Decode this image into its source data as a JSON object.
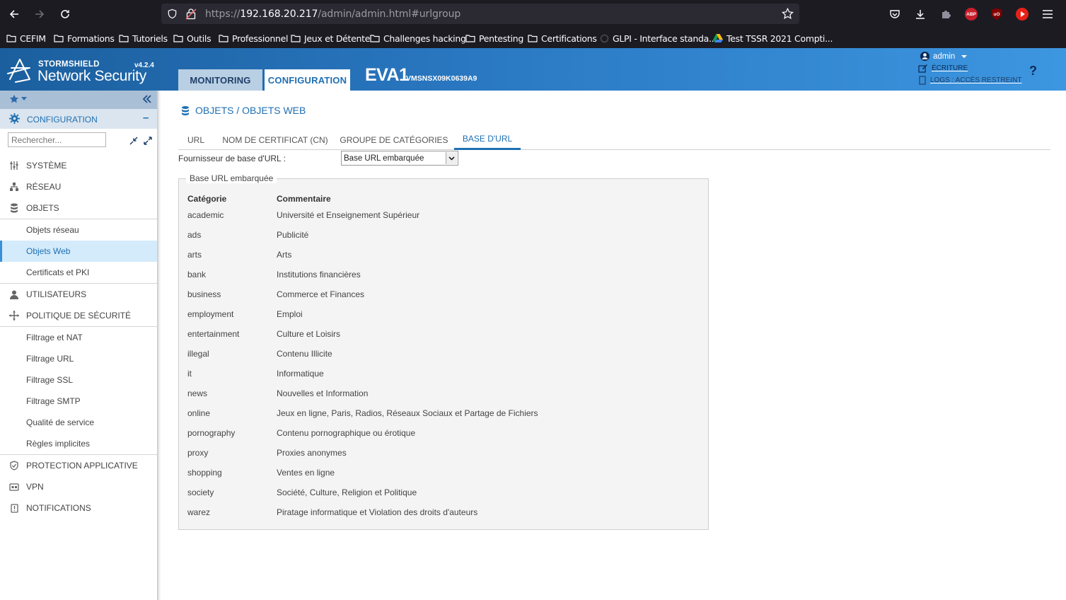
{
  "browser": {
    "url_prefix": "https://",
    "url_host": "192.168.20.217",
    "url_path": "/admin/admin.html#urlgroup",
    "bookmarks": [
      "CEFIM",
      "Formations",
      "Tutoriels",
      "Outils",
      "Professionnel",
      "Jeux et Détente",
      "Challenges hacking",
      "Pentesting",
      "Certifications",
      "GLPI - Interface standa...",
      "Test TSSR 2021 Compti..."
    ],
    "extension_labels": {
      "abp": "ABP",
      "ublock": "uO"
    }
  },
  "header": {
    "brand_top": "STORMSHIELD",
    "brand_main": "Network Security",
    "version": "v4.2.4",
    "tab_monitoring": "MONITORING",
    "tab_configuration": "CONFIGURATION",
    "firewall_name": "EVA1",
    "firewall_serial": "VMSNSX09K0639A9",
    "user": "admin",
    "write_link": "ÉCRITURE",
    "logs_link": "LOGS : ACCÈS RESTREINT",
    "help": "?"
  },
  "sidebar": {
    "section": "CONFIGURATION",
    "search_placeholder": "Rechercher...",
    "items": [
      {
        "label": "SYSTÈME"
      },
      {
        "label": "RÉSEAU"
      },
      {
        "label": "OBJETS"
      },
      {
        "label": "Objets réseau"
      },
      {
        "label": "Objets Web"
      },
      {
        "label": "Certificats et PKI"
      },
      {
        "label": "UTILISATEURS"
      },
      {
        "label": "POLITIQUE DE SÉCURITÉ"
      },
      {
        "label": "Filtrage et NAT"
      },
      {
        "label": "Filtrage URL"
      },
      {
        "label": "Filtrage SSL"
      },
      {
        "label": "Filtrage SMTP"
      },
      {
        "label": "Qualité de service"
      },
      {
        "label": "Règles implicites"
      },
      {
        "label": "PROTECTION APPLICATIVE"
      },
      {
        "label": "VPN"
      },
      {
        "label": "NOTIFICATIONS"
      }
    ]
  },
  "main": {
    "breadcrumb": "OBJETS / OBJETS WEB",
    "tabs": [
      "URL",
      "NOM DE CERTIFICAT (CN)",
      "GROUPE DE CATÉGORIES",
      "BASE D'URL"
    ],
    "provider_label": "Fournisseur de base d'URL :",
    "provider_value": "Base URL embarquée",
    "fieldset_title": "Base URL embarquée",
    "columns": [
      "Catégorie",
      "Commentaire"
    ],
    "rows": [
      [
        "academic",
        "Université et Enseignement Supérieur"
      ],
      [
        "ads",
        "Publicité"
      ],
      [
        "arts",
        "Arts"
      ],
      [
        "bank",
        "Institutions financières"
      ],
      [
        "business",
        "Commerce et Finances"
      ],
      [
        "employment",
        "Emploi"
      ],
      [
        "entertainment",
        "Culture et Loisirs"
      ],
      [
        "illegal",
        "Contenu Illicite"
      ],
      [
        "it",
        "Informatique"
      ],
      [
        "news",
        "Nouvelles et Information"
      ],
      [
        "online",
        "Jeux en ligne, Paris, Radios, Réseaux Sociaux et Partage de Fichiers"
      ],
      [
        "pornography",
        "Contenu pornographique ou érotique"
      ],
      [
        "proxy",
        "Proxies anonymes"
      ],
      [
        "shopping",
        "Ventes en ligne"
      ],
      [
        "society",
        "Société, Culture, Religion et Politique"
      ],
      [
        "warez",
        "Piratage informatique et Violation des droits d'auteurs"
      ]
    ]
  },
  "colors": {
    "accent": "#1f6fb2",
    "header_start": "#1b5f9e",
    "header_end": "#3d96e0",
    "active_item_bg": "#d4ebfb",
    "browser_bg": "#1c1b22"
  }
}
